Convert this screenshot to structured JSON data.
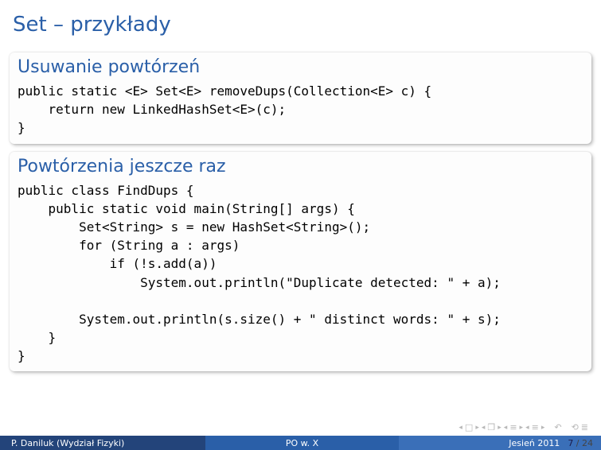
{
  "title": "Set – przykłady",
  "block1": {
    "title": "Usuwanie powtórzeń",
    "code": "public static <E> Set<E> removeDups(Collection<E> c) {\n    return new LinkedHashSet<E>(c);\n}"
  },
  "block2": {
    "title": "Powtórzenia jeszcze raz",
    "code": "public class FindDups {\n    public static void main(String[] args) {\n        Set<String> s = new HashSet<String>();\n        for (String a : args)\n            if (!s.add(a))\n                System.out.println(\"Duplicate detected: \" + a);\n\n        System.out.println(s.size() + \" distinct words: \" + s);\n    }\n}"
  },
  "footer": {
    "author": "P. Daniluk (Wydział Fizyki)",
    "course": "PO w. X",
    "term": "Jesień 2011",
    "page_current": "7",
    "page_sep": " / ",
    "page_total": "24"
  },
  "nav": {
    "first_l": "◂",
    "first_box": "□",
    "first_r": "▸",
    "frame_l": "◂",
    "frame_box": "❐",
    "frame_r": "▸",
    "sub_l": "◂",
    "sub_bar": "≡",
    "sub_r": "▸",
    "sec_l": "◂",
    "sec_bar": "≡",
    "sec_r": "▸",
    "back": "↶",
    "undo": "⟲",
    "end": "≣"
  }
}
